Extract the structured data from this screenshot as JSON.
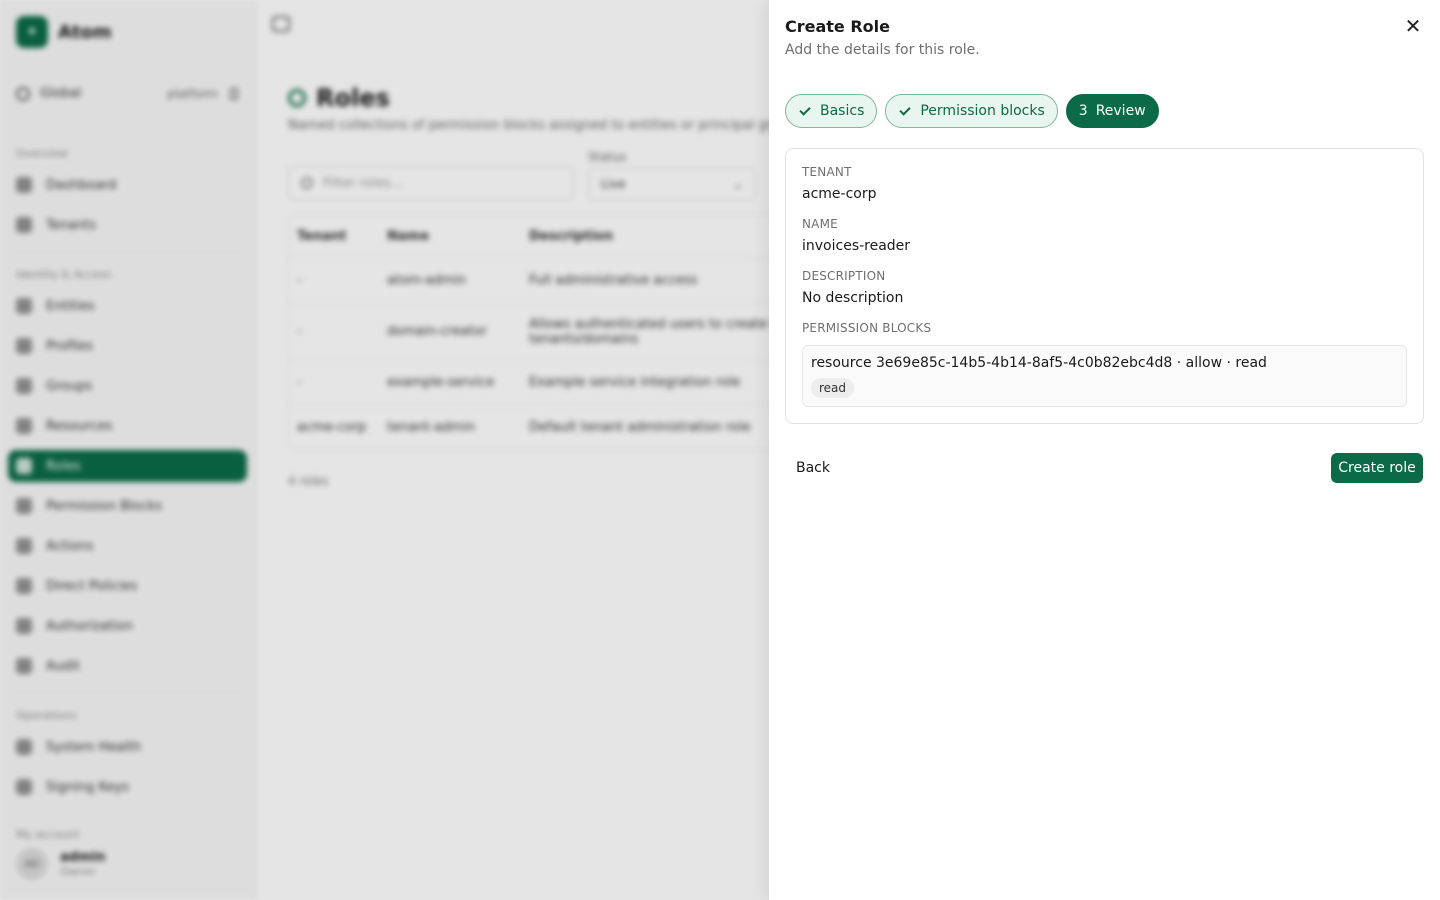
{
  "app": {
    "brand": "Atom",
    "scope": {
      "label": "Global",
      "value": "platform"
    },
    "sections": {
      "overview": "Overview",
      "identity": "Identity & Access",
      "operations": "Operations",
      "account": "My account"
    },
    "nav": {
      "dashboard": "Dashboard",
      "tenants": "Tenants",
      "entities": "Entities",
      "profiles": "Profiles",
      "groups": "Groups",
      "resources": "Resources",
      "roles": "Roles",
      "permission_blocks": "Permission Blocks",
      "actions": "Actions",
      "direct_policies": "Direct Policies",
      "authorization": "Authorization",
      "audit": "Audit",
      "system_health": "System Health",
      "signing_keys": "Signing Keys"
    },
    "user": {
      "initials": "AD",
      "name": "admin",
      "role": "Owner"
    }
  },
  "page": {
    "title": "Roles",
    "subtitle": "Named collections of permission blocks assigned to entities or principal groups",
    "filter_placeholder": "Filter roles...",
    "status_label": "Status",
    "status_value": "Live",
    "table": {
      "columns": [
        "Tenant",
        "Name",
        "Description"
      ],
      "rows": [
        {
          "tenant": "-",
          "name": "atom-admin",
          "description": "Full administrative access"
        },
        {
          "tenant": "-",
          "name": "domain-creator",
          "description": "Allows authenticated users to create their own tenants/domains"
        },
        {
          "tenant": "-",
          "name": "example-service",
          "description": "Example service integration role"
        },
        {
          "tenant": "acme-corp",
          "name": "tenant-admin",
          "description": "Default tenant administration role"
        }
      ]
    },
    "count": "4 roles"
  },
  "drawer": {
    "title": "Create Role",
    "subtitle": "Add the details for this role.",
    "close_glyph": "✕",
    "steps": [
      {
        "label": "Basics",
        "state": "done"
      },
      {
        "label": "Permission blocks",
        "state": "done"
      },
      {
        "number": "3",
        "label": "Review",
        "state": "current"
      }
    ],
    "review": {
      "tenant_label": "TENANT",
      "tenant_value": "acme-corp",
      "name_label": "NAME",
      "name_value": "invoices-reader",
      "description_label": "DESCRIPTION",
      "description_value": "No description",
      "blocks_label": "PERMISSION BLOCKS",
      "blocks": [
        {
          "summary": "resource 3e69e85c-14b5-4b14-8af5-4c0b82ebc4d8 · allow · read",
          "chip": "read"
        }
      ]
    },
    "back_label": "Back",
    "create_label": "Create role"
  },
  "colors": {
    "accent": "#0b6b48",
    "step_done_bg": "#e9f5ef",
    "step_done_border": "#7fb79c"
  }
}
